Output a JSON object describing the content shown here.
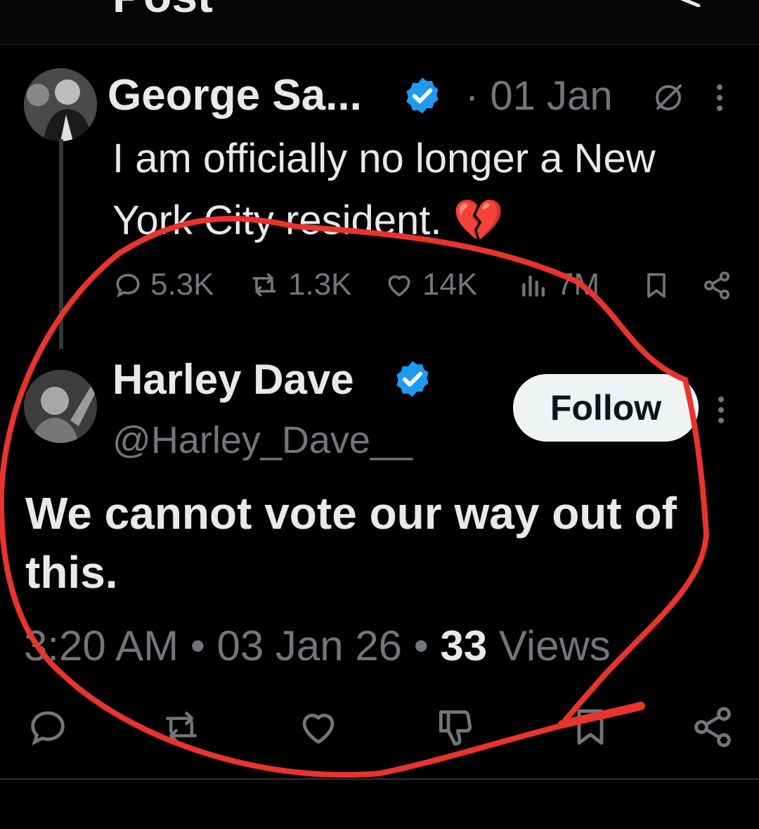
{
  "header": {
    "title": "Post"
  },
  "quoted_post": {
    "author_name": "George Sa...",
    "date": "· 01 Jan",
    "text": "I am officially no longer a New York City resident.",
    "emoji": "💔",
    "stats": {
      "replies": "5.3K",
      "reposts": "1.3K",
      "likes": "14K",
      "views": "7M"
    }
  },
  "reply_post": {
    "author_name": "Harley Dave",
    "handle": "@Harley_Dave__",
    "follow_label": "Follow",
    "text": "We cannot vote our way out of this.",
    "time": "3:20 AM",
    "date": "03 Jan 26",
    "views_count": "33",
    "views_label": "Views"
  },
  "colors": {
    "background": "#000000",
    "primary_text": "#e7e9ea",
    "muted_text": "#71767b",
    "verified_blue": "#1d9bf0",
    "annotation_red": "#e8342c",
    "follow_button_bg": "#eff3f4"
  },
  "icons": [
    "verified-badge-icon",
    "globe-slash-icon",
    "more-dots-icon",
    "reply-icon",
    "repost-icon",
    "like-icon",
    "views-icon",
    "bookmark-icon",
    "share-icon",
    "dislike-icon"
  ]
}
